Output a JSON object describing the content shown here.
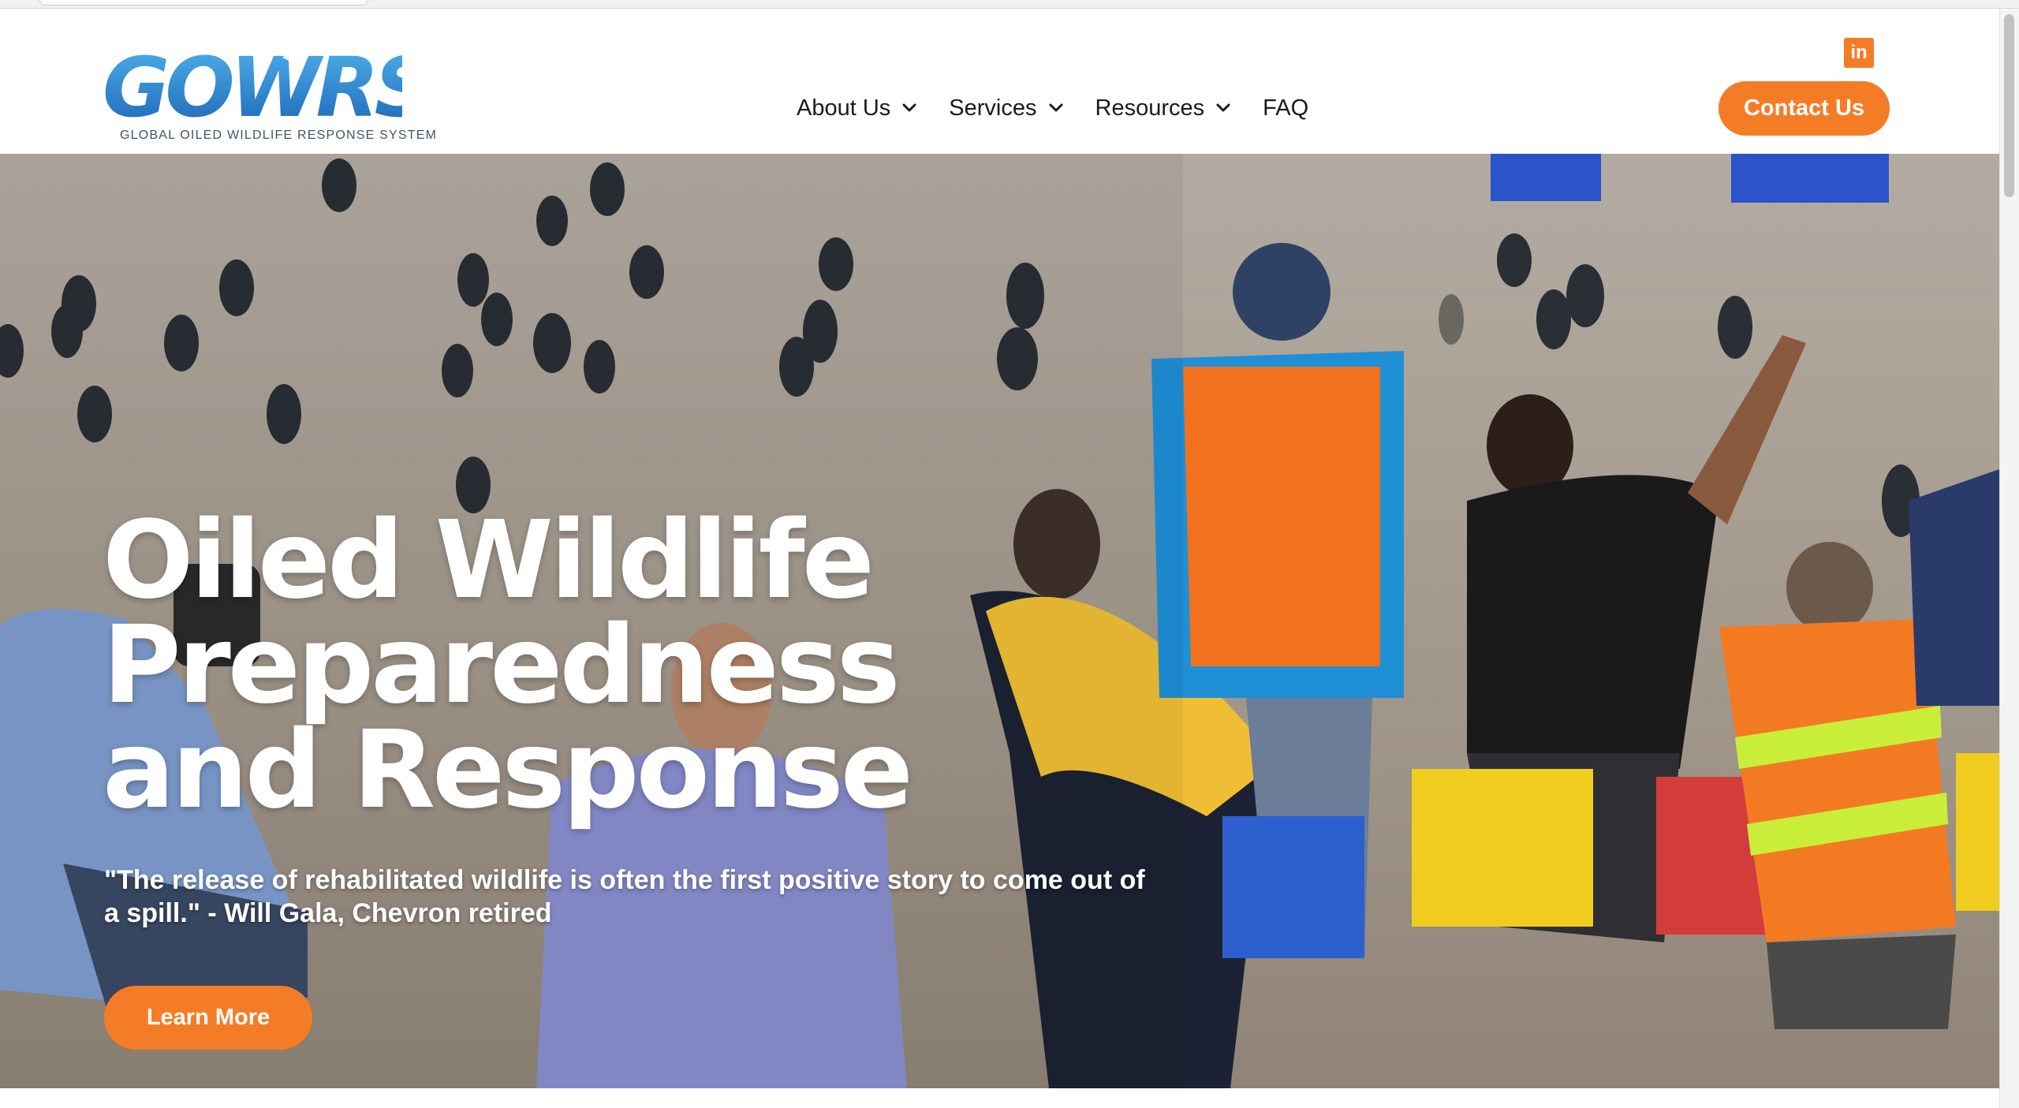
{
  "header": {
    "logo_text": "GOWRS",
    "logo_tagline": "GLOBAL OILED WILDLIFE RESPONSE SYSTEM",
    "nav": [
      {
        "label": "About Us",
        "has_dropdown": true,
        "icon": "chevron-down-icon"
      },
      {
        "label": "Services",
        "has_dropdown": true,
        "icon": "chevron-down-icon"
      },
      {
        "label": "Resources",
        "has_dropdown": true,
        "icon": "chevron-down-icon"
      },
      {
        "label": "FAQ",
        "has_dropdown": false
      }
    ],
    "social_icon": "linkedin-icon",
    "social_label": "in",
    "contact_label": "Contact Us"
  },
  "hero": {
    "title": "Oiled Wildlife Preparedness and Response",
    "quote": "\"The release of rehabilitated wildlife is often the first positive story to come out of a spill.\" - Will Gala, Chevron retired",
    "button_label": "Learn More",
    "background_image": "photo of rehabilitated penguins released on a beach with volunteers and photographers watching"
  },
  "colors": {
    "accent": "#f57c26",
    "logo_blue": "#1f78c8",
    "nav_text": "#1b1b1b",
    "hero_text": "#ffffff"
  }
}
